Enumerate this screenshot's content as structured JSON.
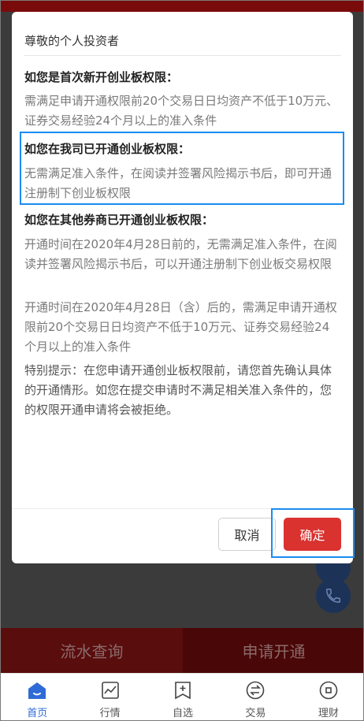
{
  "modal": {
    "greeting": "尊敬的个人投资者",
    "sections": [
      {
        "head": "如您是首次新开创业板权限：",
        "body": "需满足申请开通权限前20个交易日日均资产不低于10万元、证券交易经验24个月以上的准入条件"
      },
      {
        "head": "如您在我司已开通创业板权限：",
        "body": "无需满足准入条件，在阅读并签署风险揭示书后，即可开通注册制下创业板权限"
      },
      {
        "head": "如您在其他券商已开通创业板权限：",
        "body": "开通时间在2020年4月28日前的，无需满足准入条件，在阅读并签署风险揭示书后，可以开通注册制下创业板交易权限",
        "body2": "开通时间在2020年4月28日（含）后的，需满足申请开通权限前20个交易日日均资产不低于10万元、证券交易经验24个月以上的准入条件"
      }
    ],
    "note": "特别提示：在您申请开通创业板权限前，请您首先确认具体的开通情形。如您在提交申请时不满足相关准入条件的，您的权限开通申请将会被拒绝。",
    "cancel_label": "取消",
    "ok_label": "确定"
  },
  "background": {
    "left_action": "流水查询",
    "right_action": "申请开通"
  },
  "tabbar": {
    "items": [
      {
        "label": "首页",
        "icon": "home-icon",
        "active": true
      },
      {
        "label": "行情",
        "icon": "chart-icon",
        "active": false
      },
      {
        "label": "自选",
        "icon": "add-favorite-icon",
        "active": false
      },
      {
        "label": "交易",
        "icon": "exchange-icon",
        "active": false
      },
      {
        "label": "理财",
        "icon": "wealth-icon",
        "active": false
      }
    ]
  },
  "colors": {
    "accent_red": "#d9322f",
    "tab_active": "#2f6bd6",
    "highlight_box": "#1a8cf0"
  }
}
